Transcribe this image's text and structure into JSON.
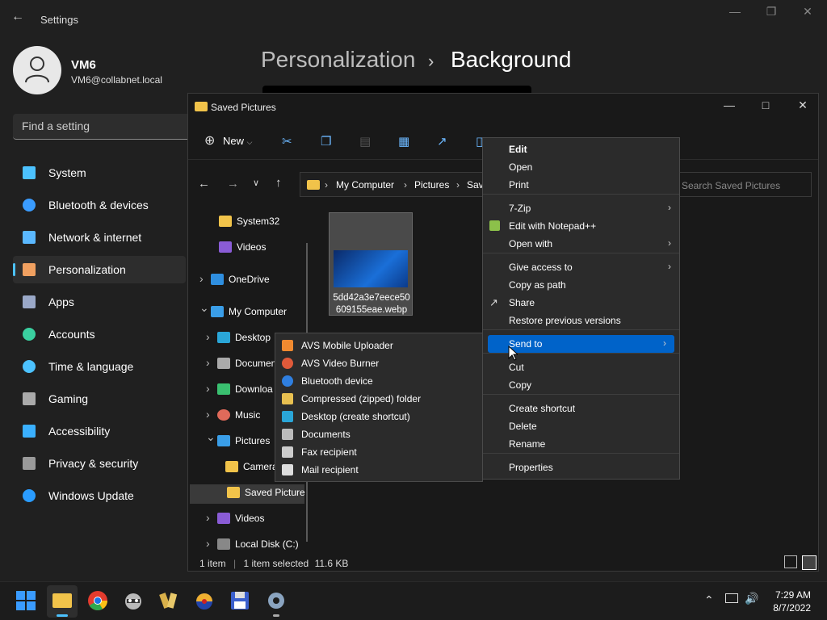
{
  "settings": {
    "window_title": "Settings",
    "user_name": "VM6",
    "user_email": "VM6@collabnet.local",
    "find_placeholder": "Find a setting",
    "nav": [
      {
        "label": "System",
        "icon": "monitor-icon",
        "color": "#4cc2ff"
      },
      {
        "label": "Bluetooth & devices",
        "icon": "bluetooth-icon",
        "color": "#3a9cff"
      },
      {
        "label": "Network & internet",
        "icon": "wifi-icon",
        "color": "#5ab8ff"
      },
      {
        "label": "Personalization",
        "icon": "brush-icon",
        "color": "#f0a060"
      },
      {
        "label": "Apps",
        "icon": "apps-icon",
        "color": "#9aa8c8"
      },
      {
        "label": "Accounts",
        "icon": "person-icon",
        "color": "#3ad0a0"
      },
      {
        "label": "Time & language",
        "icon": "clock-globe-icon",
        "color": "#4cc2ff"
      },
      {
        "label": "Gaming",
        "icon": "gamepad-icon",
        "color": "#aaaaaa"
      },
      {
        "label": "Accessibility",
        "icon": "accessibility-icon",
        "color": "#3ab0ff"
      },
      {
        "label": "Privacy & security",
        "icon": "shield-icon",
        "color": "#9a9a9a"
      },
      {
        "label": "Windows Update",
        "icon": "update-icon",
        "color": "#2a9cff"
      }
    ],
    "breadcrumb_parent": "Personalization",
    "breadcrumb_sep": "›",
    "breadcrumb_current": "Background"
  },
  "explorer": {
    "title": "Saved Pictures",
    "new_label": "New",
    "address": [
      "My Computer",
      "Pictures",
      "Sav"
    ],
    "search_placeholder": "Search Saved Pictures",
    "tree": [
      {
        "label": "System32",
        "icon": "folder-icon"
      },
      {
        "label": "Videos",
        "icon": "videos-icon"
      },
      {
        "label": "OneDrive",
        "icon": "cloud-icon"
      },
      {
        "label": "My Computer",
        "icon": "computer-icon"
      },
      {
        "label": "Desktop",
        "icon": "desktop-icon"
      },
      {
        "label": "Documen",
        "icon": "documents-icon"
      },
      {
        "label": "Downloa",
        "icon": "download-icon"
      },
      {
        "label": "Music",
        "icon": "music-icon"
      },
      {
        "label": "Pictures",
        "icon": "pictures-icon"
      },
      {
        "label": "Camera",
        "icon": "folder-icon"
      },
      {
        "label": "Saved Picture",
        "icon": "folder-icon"
      },
      {
        "label": "Videos",
        "icon": "videos-icon"
      },
      {
        "label": "Local Disk (C:)",
        "icon": "disk-icon"
      }
    ],
    "file_name_line1": "5dd42a3e7eece50",
    "file_name_line2": "609155eae.webp",
    "status_items": "1 item",
    "status_selected": "1 item selected",
    "status_size": "11.6 KB"
  },
  "context_menu": {
    "items": [
      {
        "label": "Edit",
        "bold": true
      },
      {
        "label": "Open"
      },
      {
        "label": "Print"
      },
      {
        "label": "7-Zip",
        "submenu": true
      },
      {
        "label": "Edit with Notepad++",
        "icon": "notepadpp-icon"
      },
      {
        "label": "Open with",
        "submenu": true
      },
      {
        "label": "Give access to",
        "submenu": true
      },
      {
        "label": "Copy as path"
      },
      {
        "label": "Share",
        "icon": "share-icon"
      },
      {
        "label": "Restore previous versions"
      },
      {
        "label": "Send to",
        "submenu": true,
        "highlighted": true
      },
      {
        "label": "Cut"
      },
      {
        "label": "Copy"
      },
      {
        "label": "Create shortcut"
      },
      {
        "label": "Delete"
      },
      {
        "label": "Rename"
      },
      {
        "label": "Properties"
      }
    ]
  },
  "send_to_menu": {
    "items": [
      {
        "label": "AVS Mobile Uploader",
        "icon": "avs-uploader-icon"
      },
      {
        "label": "AVS Video Burner",
        "icon": "avs-burner-icon"
      },
      {
        "label": "Bluetooth device",
        "icon": "bluetooth-icon"
      },
      {
        "label": "Compressed (zipped) folder",
        "icon": "zip-folder-icon"
      },
      {
        "label": "Desktop (create shortcut)",
        "icon": "desktop-icon"
      },
      {
        "label": "Documents",
        "icon": "documents-icon"
      },
      {
        "label": "Fax recipient",
        "icon": "fax-icon"
      },
      {
        "label": "Mail recipient",
        "icon": "mail-icon"
      }
    ]
  },
  "taskbar": {
    "time": "7:29 AM",
    "date": "8/7/2022"
  },
  "colors": {
    "accent": "#0063c9",
    "settings_accent": "#4cc2ff",
    "folder": "#f1c34a"
  }
}
